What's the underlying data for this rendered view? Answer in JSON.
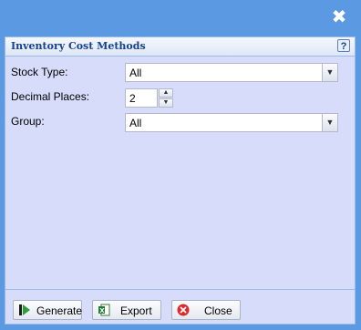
{
  "window": {
    "close_glyph": "✖"
  },
  "panel": {
    "title": "Inventory Cost Methods",
    "help_glyph": "?"
  },
  "form": {
    "stock_type": {
      "label": "Stock Type:",
      "value": "All"
    },
    "decimal_places": {
      "label": "Decimal Places:",
      "value": "2"
    },
    "group": {
      "label": "Group:",
      "value": "All"
    }
  },
  "buttons": {
    "generate": {
      "label": "Generate",
      "icon": "play-icon"
    },
    "export": {
      "label": "Export",
      "icon": "excel-icon"
    },
    "close": {
      "label": "Close",
      "icon": "close-circle-icon"
    }
  },
  "colors": {
    "window_bg": "#5b9ae2",
    "panel_bg": "#d6dcfa",
    "title_color": "#15428b"
  }
}
